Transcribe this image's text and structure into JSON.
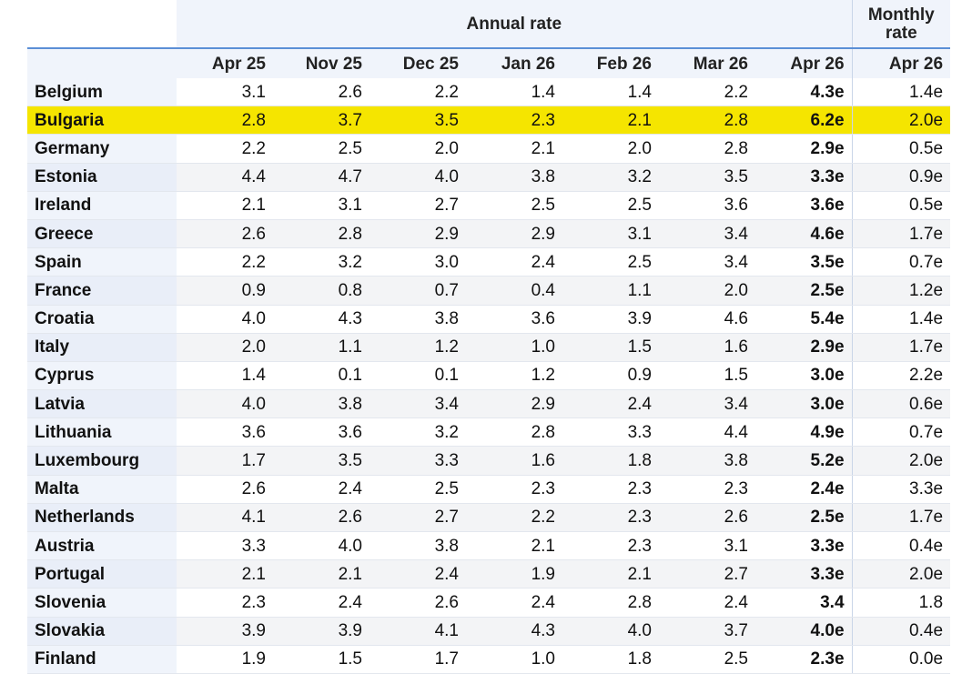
{
  "header": {
    "annual_label": "Annual rate",
    "monthly_label_line1": "Monthly",
    "monthly_label_line2": "rate",
    "columns": [
      "Apr 25",
      "Nov 25",
      "Dec 25",
      "Jan 26",
      "Feb 26",
      "Mar 26",
      "Apr 26",
      "Apr 26"
    ]
  },
  "highlight_color": "#f5e500",
  "rows": [
    {
      "country": "Belgium",
      "values": [
        "3.1",
        "2.6",
        "2.2",
        "1.4",
        "1.4",
        "2.2",
        "4.3e",
        "1.4e"
      ]
    },
    {
      "country": "Bulgaria",
      "values": [
        "2.8",
        "3.7",
        "3.5",
        "2.3",
        "2.1",
        "2.8",
        "6.2e",
        "2.0e"
      ],
      "highlighted": true
    },
    {
      "country": "Germany",
      "values": [
        "2.2",
        "2.5",
        "2.0",
        "2.1",
        "2.0",
        "2.8",
        "2.9e",
        "0.5e"
      ]
    },
    {
      "country": "Estonia",
      "values": [
        "4.4",
        "4.7",
        "4.0",
        "3.8",
        "3.2",
        "3.5",
        "3.3e",
        "0.9e"
      ]
    },
    {
      "country": "Ireland",
      "values": [
        "2.1",
        "3.1",
        "2.7",
        "2.5",
        "2.5",
        "3.6",
        "3.6e",
        "0.5e"
      ]
    },
    {
      "country": "Greece",
      "values": [
        "2.6",
        "2.8",
        "2.9",
        "2.9",
        "3.1",
        "3.4",
        "4.6e",
        "1.7e"
      ]
    },
    {
      "country": "Spain",
      "values": [
        "2.2",
        "3.2",
        "3.0",
        "2.4",
        "2.5",
        "3.4",
        "3.5e",
        "0.7e"
      ]
    },
    {
      "country": "France",
      "values": [
        "0.9",
        "0.8",
        "0.7",
        "0.4",
        "1.1",
        "2.0",
        "2.5e",
        "1.2e"
      ]
    },
    {
      "country": "Croatia",
      "values": [
        "4.0",
        "4.3",
        "3.8",
        "3.6",
        "3.9",
        "4.6",
        "5.4e",
        "1.4e"
      ]
    },
    {
      "country": "Italy",
      "values": [
        "2.0",
        "1.1",
        "1.2",
        "1.0",
        "1.5",
        "1.6",
        "2.9e",
        "1.7e"
      ]
    },
    {
      "country": "Cyprus",
      "values": [
        "1.4",
        "0.1",
        "0.1",
        "1.2",
        "0.9",
        "1.5",
        "3.0e",
        "2.2e"
      ]
    },
    {
      "country": "Latvia",
      "values": [
        "4.0",
        "3.8",
        "3.4",
        "2.9",
        "2.4",
        "3.4",
        "3.0e",
        "0.6e"
      ]
    },
    {
      "country": "Lithuania",
      "values": [
        "3.6",
        "3.6",
        "3.2",
        "2.8",
        "3.3",
        "4.4",
        "4.9e",
        "0.7e"
      ]
    },
    {
      "country": "Luxembourg",
      "values": [
        "1.7",
        "3.5",
        "3.3",
        "1.6",
        "1.8",
        "3.8",
        "5.2e",
        "2.0e"
      ]
    },
    {
      "country": "Malta",
      "values": [
        "2.6",
        "2.4",
        "2.5",
        "2.3",
        "2.3",
        "2.3",
        "2.4e",
        "3.3e"
      ]
    },
    {
      "country": "Netherlands",
      "values": [
        "4.1",
        "2.6",
        "2.7",
        "2.2",
        "2.3",
        "2.6",
        "2.5e",
        "1.7e"
      ]
    },
    {
      "country": "Austria",
      "values": [
        "3.3",
        "4.0",
        "3.8",
        "2.1",
        "2.3",
        "3.1",
        "3.3e",
        "0.4e"
      ]
    },
    {
      "country": "Portugal",
      "values": [
        "2.1",
        "2.1",
        "2.4",
        "1.9",
        "2.1",
        "2.7",
        "3.3e",
        "2.0e"
      ]
    },
    {
      "country": "Slovenia",
      "values": [
        "2.3",
        "2.4",
        "2.6",
        "2.4",
        "2.8",
        "2.4",
        "3.4",
        "1.8"
      ]
    },
    {
      "country": "Slovakia",
      "values": [
        "3.9",
        "3.9",
        "4.1",
        "4.3",
        "4.0",
        "3.7",
        "4.0e",
        "0.4e"
      ]
    },
    {
      "country": "Finland",
      "values": [
        "1.9",
        "1.5",
        "1.7",
        "1.0",
        "1.8",
        "2.5",
        "2.3e",
        "0.0e"
      ]
    }
  ]
}
